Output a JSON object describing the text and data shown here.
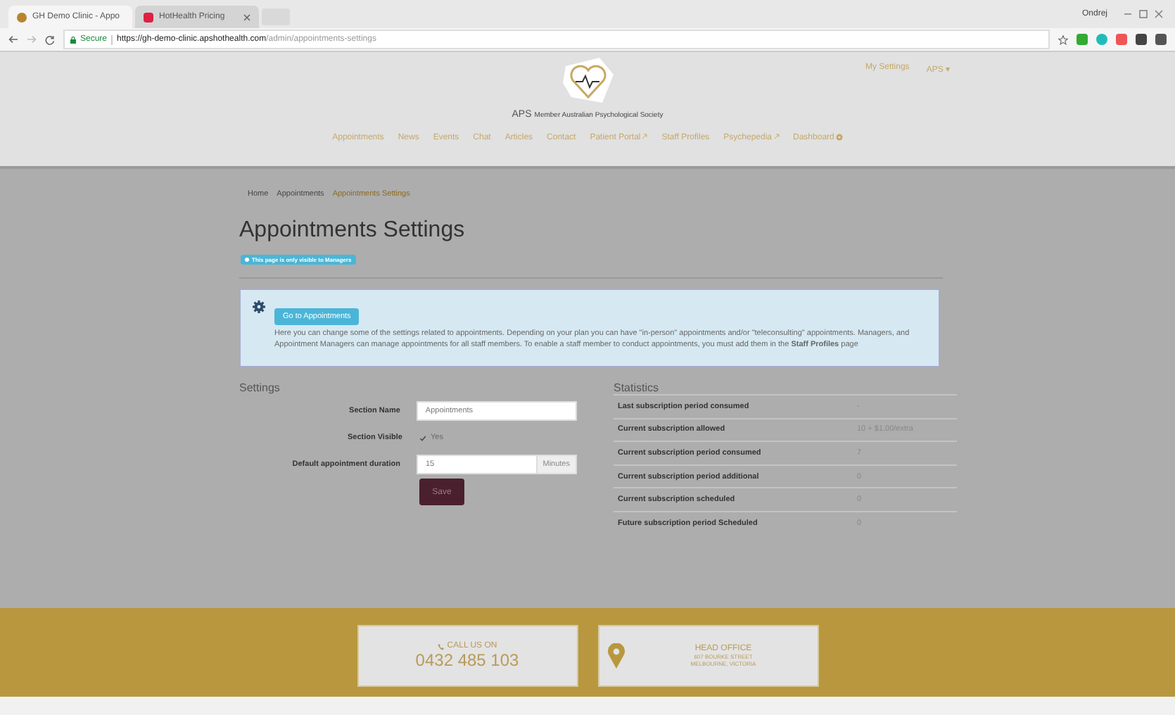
{
  "browser": {
    "tabs": [
      {
        "title": "GH Demo Clinic - Appo",
        "selected": true
      },
      {
        "title": "HotHealth Pricing",
        "selected": false
      }
    ],
    "profile": "Ondrej",
    "secure_label": "Secure",
    "url_host": "https://gh-demo-clinic.apshothealth.com",
    "url_path": "/admin/appointments-settings"
  },
  "header": {
    "top_links": [
      "My Settings",
      "APS ▾"
    ],
    "logo_text": "APS",
    "logo_subtitle": "Member Australian Psychological Society",
    "nav": [
      {
        "label": "Appointments",
        "external": false
      },
      {
        "label": "News",
        "external": false
      },
      {
        "label": "Events",
        "external": false
      },
      {
        "label": "Chat",
        "external": false
      },
      {
        "label": "Articles",
        "external": false
      },
      {
        "label": "Contact",
        "external": false
      },
      {
        "label": "Patient Portal",
        "external": true
      },
      {
        "label": "Staff Profiles",
        "external": false
      },
      {
        "label": "Psychepedia",
        "external": true
      },
      {
        "label": "Dashboard",
        "external": false,
        "gear": true
      }
    ]
  },
  "breadcrumb": [
    {
      "label": "Home",
      "selected": false
    },
    {
      "label": "Appointments",
      "selected": false
    },
    {
      "label": "Appointments Settings",
      "selected": true
    }
  ],
  "title": "Appointments Settings",
  "visibility_badge": "This page is only visible to Managers",
  "info": {
    "button": "Go to Appointments",
    "text": "Here you can change some of the settings related to appointments. Depending on your plan you can have \"in-person\" appointments and/or \"teleconsulting\" appointments. Managers, and Appointment Managers can manage appointments for all staff members. To enable a staff member to conduct appointments, you must add them in the **Staff Profiles** page"
  },
  "settings": {
    "heading": "Settings",
    "section_name_label": "Section Name",
    "section_name": "Appointments",
    "visible_label": "Section Visible",
    "visible_checked": true,
    "visible_text": "Yes",
    "duration_label": "Default appointment duration",
    "duration": "15",
    "duration_unit": "Minutes",
    "save": "Save"
  },
  "statistics": {
    "heading": "Statistics",
    "rows": [
      {
        "label": "Last subscription period consumed",
        "value": "-"
      },
      {
        "label": "Current subscription allowed",
        "value": "10 + $1.00/extra"
      },
      {
        "label": "Current subscription period consumed",
        "value": "7"
      },
      {
        "label": "Current subscription period additional",
        "value": "0"
      },
      {
        "label": "Current subscription scheduled",
        "value": "0"
      },
      {
        "label": "Future subscription period Scheduled",
        "value": "0"
      }
    ]
  },
  "footer": {
    "call_label": "CALL US ON",
    "phone": "0432 485 103",
    "office_label": "HEAD OFFICE",
    "address_lines": [
      "607 BOURKE STREET",
      "MELBOURNE, VICTORIA"
    ]
  }
}
